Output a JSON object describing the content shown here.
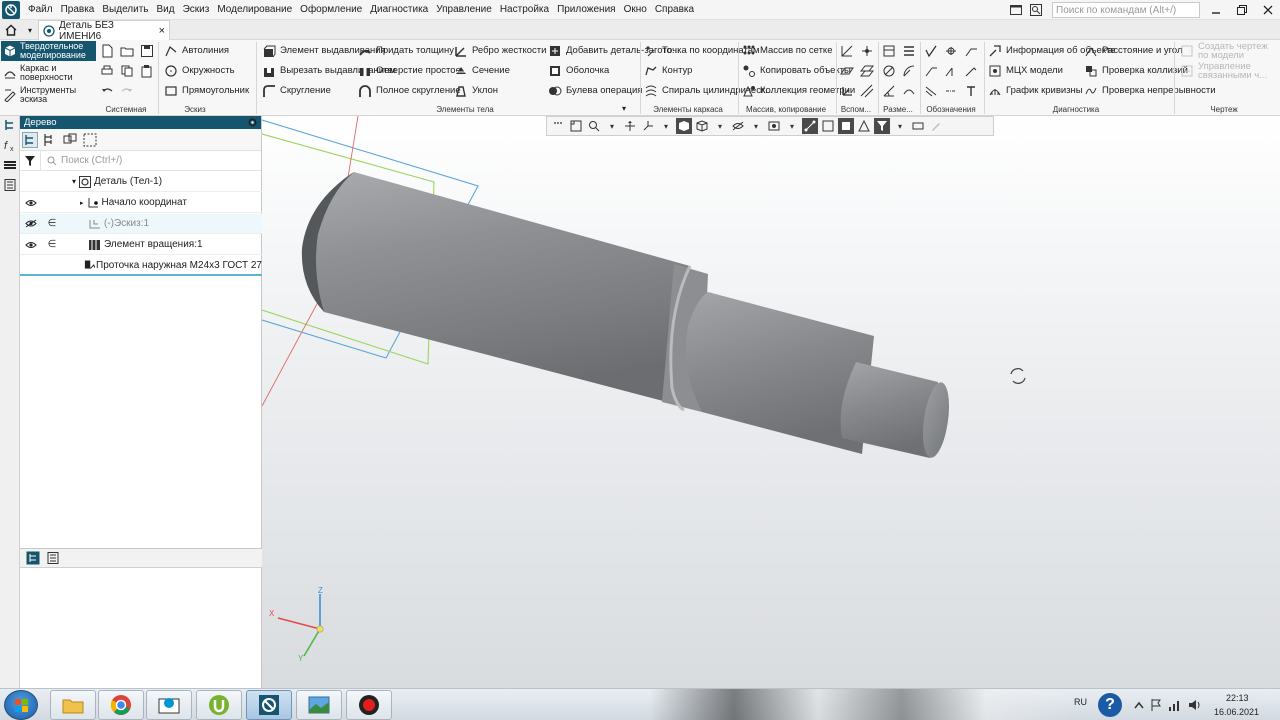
{
  "menu": {
    "items": [
      "Файл",
      "Правка",
      "Выделить",
      "Вид",
      "Эскиз",
      "Моделирование",
      "Оформление",
      "Диагностика",
      "Управление",
      "Настройка",
      "Приложения",
      "Окно",
      "Справка"
    ],
    "command_search_placeholder": "Поиск по командам (Alt+/)"
  },
  "tabs": {
    "document": "Деталь БЕЗ ИМЕНИ6",
    "close": "×"
  },
  "ribbon": {
    "modes": [
      "Твердотельное моделирование",
      "Каркас и поверхности",
      "Инструменты эскиза"
    ],
    "groups": [
      "Системная",
      "Эскиз",
      "Элементы тела",
      "Элементы каркаса",
      "Массив, копирование",
      "Вспом...",
      "Разме...",
      "Обозначения",
      "Диагностика",
      "Чертеж"
    ],
    "sketch": [
      "Автолиния",
      "Окружность",
      "Прямоугольник"
    ],
    "body_col1": [
      "Элемент выдавливания",
      "Вырезать выдавливанием",
      "Скругление"
    ],
    "body_col2": [
      "Придать толщину",
      "Отверстие простое",
      "Полное скругление"
    ],
    "body_col3": [
      "Ребро жесткости",
      "Сечение",
      "Уклон"
    ],
    "body_col4": [
      "Добавить деталь-загото...",
      "Оболочка",
      "Булева операция"
    ],
    "frame": [
      "Точка по координатам",
      "Контур",
      "Спираль цилиндрическ..."
    ],
    "array": [
      "Массив по сетке",
      "Копировать объекты",
      "Коллекция геометрии"
    ],
    "diag_col1": [
      "Информация об объекте",
      "МЦХ модели",
      "График кривизны"
    ],
    "diag_col2": [
      "Расстояние и угол",
      "Проверка коллизий",
      "Проверка непрерывности"
    ],
    "drawing": [
      "Создать чертеж по модели",
      "Управление связанными ч..."
    ]
  },
  "tree": {
    "title": "Дерево",
    "search_placeholder": "Поиск (Ctrl+/)",
    "nodes": [
      {
        "label": "Деталь (Тел-1)"
      },
      {
        "label": "Начало координат"
      },
      {
        "label": "(-)Эскиз:1"
      },
      {
        "label": "Элемент вращения:1"
      },
      {
        "label": "Проточка наружная М24х3 ГОСТ 27"
      }
    ]
  },
  "triad": {
    "x": "X",
    "y": "Y",
    "z": "Z"
  },
  "taskbar": {
    "lang": "RU",
    "time": "22:13",
    "date": "16.06.2021"
  },
  "colors": {
    "accent": "#15566e",
    "viewport_top": "#ffffff",
    "viewport_bottom": "#d9dcdf",
    "part_gray": "#8f9194"
  }
}
